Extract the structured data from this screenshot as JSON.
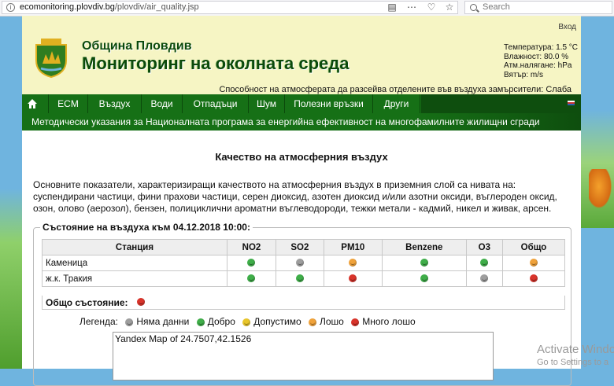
{
  "browser": {
    "url_domain": "ecomonitoring.plovdiv.bg",
    "url_path": "/plovdiv/air_quality.jsp",
    "search_placeholder": "Search"
  },
  "header": {
    "login": "Вход",
    "municipality": "Община Пловдив",
    "site_title": "Мониторинг на околната среда",
    "weather": {
      "temperature": "Температура: 1.5 °C",
      "humidity": "Влажност: 80.0 %",
      "pressure": "Атм.налягане: hPa",
      "wind": "Вятър: m/s"
    },
    "dispersion": "Способност на атмосферата да разсейва отделените във въздуха замърсители: Слаба"
  },
  "nav": {
    "items": [
      {
        "label": "ECM"
      },
      {
        "label": "Въздух"
      },
      {
        "label": "Води"
      },
      {
        "label": "Отпадъци"
      },
      {
        "label": "Шум"
      },
      {
        "label": "Полезни връзки"
      },
      {
        "label": "Други"
      }
    ]
  },
  "announcement": "Методически указания за Националната програма за енергийна ефективност на многофамилните жилищни сгради",
  "main": {
    "heading": "Качество на атмосферния въздух",
    "intro": "Основните показатели, характеризиращи качеството на атмосферния въздух в приземния слой са нивата на: суспендирани частици, фини прахови частици, серен диоксид, азотен диоксид и/или азотни оксиди, въглероден оксид, озон, олово (аерозол), бензен, полициклични ароматни въглеводороди, тежки метали - кадмий, никел и живак, арсен.",
    "status_title": "Състояние на въздуха към 04.12.2018 10:00:",
    "table": {
      "columns": [
        "Станция",
        "NO2",
        "SO2",
        "PM10",
        "Benzene",
        "O3",
        "Общо"
      ],
      "rows": [
        {
          "station": "Каменица",
          "levels": [
            "good",
            "nodata",
            "acceptable",
            "good",
            "good",
            "acceptable"
          ]
        },
        {
          "station": "ж.к. Тракия",
          "levels": [
            "good",
            "good",
            "verybad",
            "good",
            "nodata",
            "verybad"
          ]
        }
      ]
    },
    "overall_label": "Общо състояние:",
    "overall_level": "verybad",
    "legend": {
      "label": "Легенда:",
      "items": [
        {
          "level": "nodata",
          "label": "Няма данни"
        },
        {
          "level": "good",
          "label": "Добро"
        },
        {
          "level": "moderate",
          "label": "Допустимо"
        },
        {
          "level": "acceptable",
          "label": "Лошо"
        },
        {
          "level": "verybad",
          "label": "Много лошо"
        }
      ]
    },
    "map_text": "Yandex Map of 24.7507,42.1526"
  },
  "level_colors": {
    "nodata": "#9e9e9e",
    "good": "#3fae49",
    "moderate": "#e8c52a",
    "acceptable": "#f0a23a",
    "verybad": "#d9342b"
  },
  "watermark": {
    "line1": "Activate Windo",
    "line2": "Go to Settings to a"
  }
}
